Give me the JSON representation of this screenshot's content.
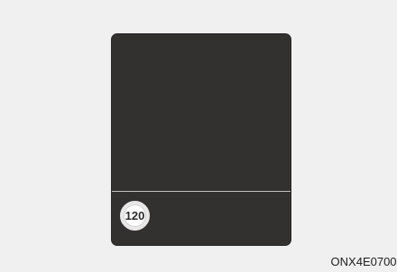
{
  "display": {
    "speed_limit_sign": {
      "value": "120"
    }
  },
  "image_code": "ONX4E070096"
}
